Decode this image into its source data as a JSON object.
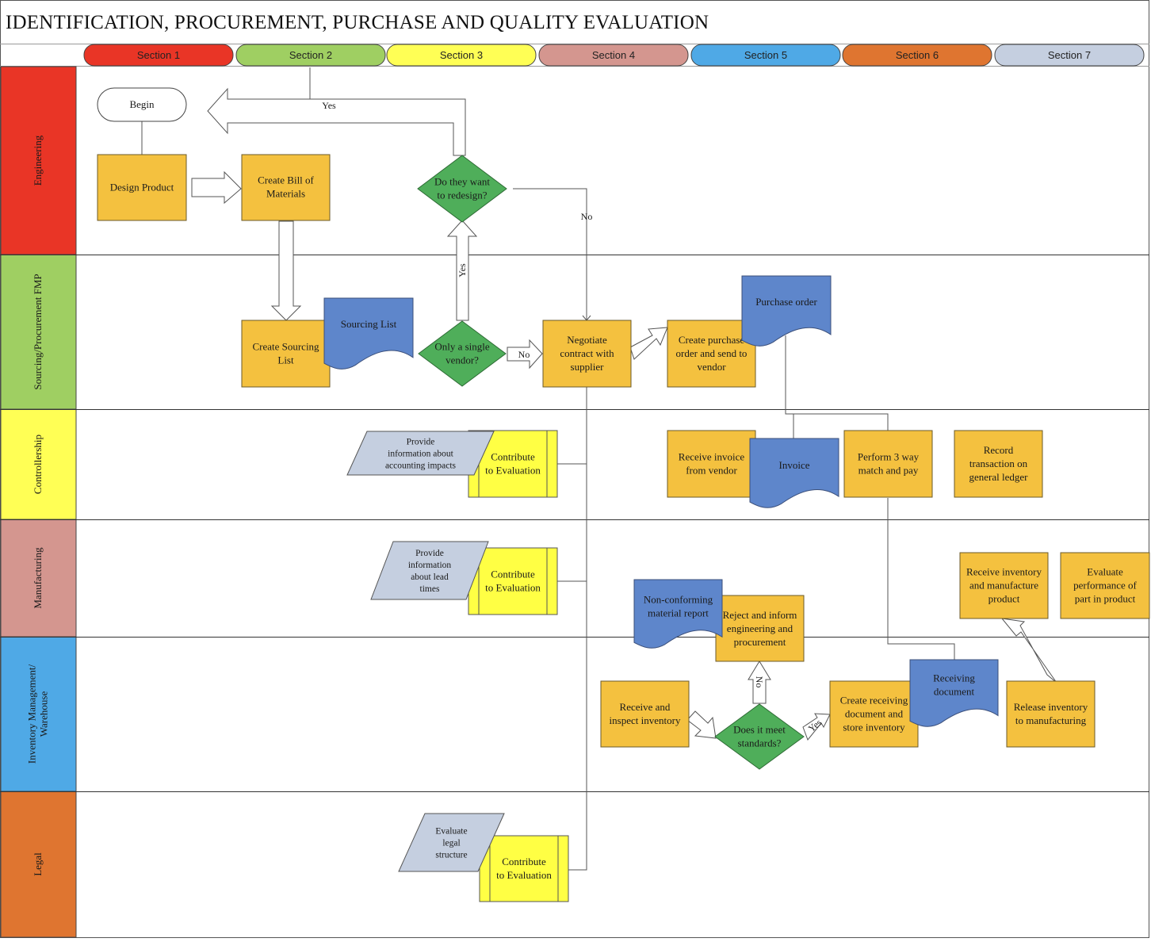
{
  "title": "IDENTIFICATION, PROCUREMENT, PURCHASE AND QUALITY EVALUATION",
  "sections": [
    {
      "label": "Section 1",
      "color": "#e93526"
    },
    {
      "label": "Section 2",
      "color": "#9fcf62"
    },
    {
      "label": "Section 3",
      "color": "#ffff55"
    },
    {
      "label": "Section 4",
      "color": "#d4968f"
    },
    {
      "label": "Section 5",
      "color": "#4fa9e6"
    },
    {
      "label": "Section 6",
      "color": "#df7530"
    },
    {
      "label": "Section 7",
      "color": "#c5cfe0"
    }
  ],
  "lanes": [
    {
      "label": "Engineering",
      "color": "#e93526"
    },
    {
      "label": "Sourcing/Procurement FMP",
      "color": "#9fcf62"
    },
    {
      "label": "Controllership",
      "color": "#ffff55"
    },
    {
      "label": "Manufacturing",
      "color": "#d4968f"
    },
    {
      "label": "Inventory Management/ Warehouse",
      "label_lines": [
        "Inventory Management/",
        "Warehouse"
      ],
      "color": "#4fa9e6"
    },
    {
      "label": "Legal",
      "color": "#df7530"
    }
  ],
  "colors": {
    "process": "#f4c13f",
    "document": "#5e86cb",
    "decision": "#4fae5a",
    "data": "#c5cfe0",
    "predefined": "#ffff44",
    "terminator": "#ffffff"
  },
  "nodes": {
    "begin": {
      "lines": [
        "Begin"
      ]
    },
    "design_product": {
      "lines": [
        "Design Product"
      ]
    },
    "create_bom": {
      "lines": [
        "Create Bill of",
        "Materials"
      ]
    },
    "redesign_decision": {
      "lines": [
        "Do they want",
        "to redesign?"
      ]
    },
    "create_sourcing_list": {
      "lines": [
        "Create Sourcing",
        "List"
      ]
    },
    "sourcing_list_doc": {
      "lines": [
        "Sourcing List"
      ]
    },
    "single_vendor_decision": {
      "lines": [
        "Only a single",
        "vendor?"
      ]
    },
    "negotiate_contract": {
      "lines": [
        "Negotiate",
        "contract with",
        "supplier"
      ]
    },
    "create_po": {
      "lines": [
        "Create purchase",
        "order and send to",
        "vendor"
      ]
    },
    "purchase_order_doc": {
      "lines": [
        "Purchase order"
      ]
    },
    "provide_accounting": {
      "lines": [
        "Provide",
        "information about",
        "accounting impacts"
      ]
    },
    "contribute_controllership": {
      "lines": [
        "Contribute",
        "to Evaluation"
      ]
    },
    "receive_invoice": {
      "lines": [
        "Receive invoice",
        "from vendor"
      ]
    },
    "invoice_doc": {
      "lines": [
        "Invoice"
      ]
    },
    "three_way_match": {
      "lines": [
        "Perform 3 way",
        "match and pay"
      ]
    },
    "record_transaction": {
      "lines": [
        "Record",
        "transaction on",
        "general ledger"
      ]
    },
    "provide_lead_times": {
      "lines": [
        "Provide",
        "information",
        "about lead",
        "times"
      ]
    },
    "contribute_manufacturing": {
      "lines": [
        "Contribute",
        "to Evaluation"
      ]
    },
    "nonconforming_doc": {
      "lines": [
        "Non-conforming",
        "material report"
      ]
    },
    "reject_inform": {
      "lines": [
        "Reject and inform",
        "engineering and",
        "procurement"
      ]
    },
    "receive_manufacture": {
      "lines": [
        "Receive inventory",
        "and manufacture",
        "product"
      ]
    },
    "evaluate_performance": {
      "lines": [
        "Evaluate",
        "performance of",
        "part in product"
      ]
    },
    "receive_inspect": {
      "lines": [
        "Receive and",
        "inspect inventory"
      ]
    },
    "meet_standards_decision": {
      "lines": [
        "Does it meet",
        "standards?"
      ]
    },
    "create_receiving": {
      "lines": [
        "Create receiving",
        "document and",
        "store inventory"
      ]
    },
    "receiving_doc": {
      "lines": [
        "Receiving",
        "document"
      ]
    },
    "release_inventory": {
      "lines": [
        "Release inventory",
        "to manufacturing"
      ]
    },
    "evaluate_legal": {
      "lines": [
        "Evaluate",
        "legal",
        "structure"
      ]
    },
    "contribute_legal": {
      "lines": [
        "Contribute",
        "to Evaluation"
      ]
    }
  },
  "edge_labels": {
    "redesign_yes": "Yes",
    "redesign_no": "No",
    "single_vendor_yes": "Yes",
    "single_vendor_no": "No",
    "standards_no": "No",
    "standards_yes": "Yes"
  }
}
